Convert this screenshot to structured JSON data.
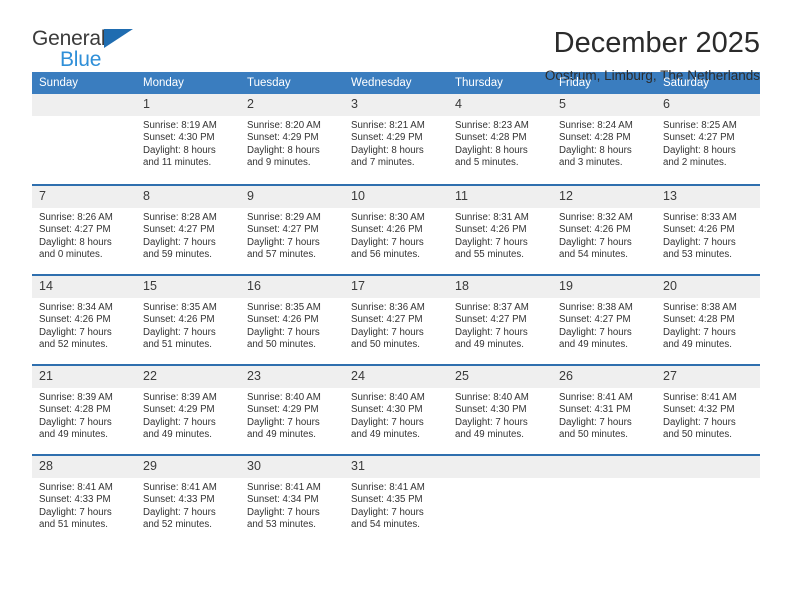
{
  "logo": {
    "line1": "General",
    "line2": "Blue",
    "triangle_color": "#1f6cb0",
    "line2_color": "#2f8fd8"
  },
  "header": {
    "title": "December 2025",
    "subtitle": "Oostrum, Limburg, The Netherlands"
  },
  "theme": {
    "header_bg": "#3a7dbf",
    "week_rule": "#2f6fae",
    "daynum_bg": "#efefef"
  },
  "weekday_headers": [
    "Sunday",
    "Monday",
    "Tuesday",
    "Wednesday",
    "Thursday",
    "Friday",
    "Saturday"
  ],
  "weeks": [
    [
      {
        "day": "",
        "sunrise": "",
        "sunset": "",
        "daylight1": "",
        "daylight2": "",
        "empty": true
      },
      {
        "day": "1",
        "sunrise": "Sunrise: 8:19 AM",
        "sunset": "Sunset: 4:30 PM",
        "daylight1": "Daylight: 8 hours",
        "daylight2": "and 11 minutes."
      },
      {
        "day": "2",
        "sunrise": "Sunrise: 8:20 AM",
        "sunset": "Sunset: 4:29 PM",
        "daylight1": "Daylight: 8 hours",
        "daylight2": "and 9 minutes."
      },
      {
        "day": "3",
        "sunrise": "Sunrise: 8:21 AM",
        "sunset": "Sunset: 4:29 PM",
        "daylight1": "Daylight: 8 hours",
        "daylight2": "and 7 minutes."
      },
      {
        "day": "4",
        "sunrise": "Sunrise: 8:23 AM",
        "sunset": "Sunset: 4:28 PM",
        "daylight1": "Daylight: 8 hours",
        "daylight2": "and 5 minutes."
      },
      {
        "day": "5",
        "sunrise": "Sunrise: 8:24 AM",
        "sunset": "Sunset: 4:28 PM",
        "daylight1": "Daylight: 8 hours",
        "daylight2": "and 3 minutes."
      },
      {
        "day": "6",
        "sunrise": "Sunrise: 8:25 AM",
        "sunset": "Sunset: 4:27 PM",
        "daylight1": "Daylight: 8 hours",
        "daylight2": "and 2 minutes."
      }
    ],
    [
      {
        "day": "7",
        "sunrise": "Sunrise: 8:26 AM",
        "sunset": "Sunset: 4:27 PM",
        "daylight1": "Daylight: 8 hours",
        "daylight2": "and 0 minutes."
      },
      {
        "day": "8",
        "sunrise": "Sunrise: 8:28 AM",
        "sunset": "Sunset: 4:27 PM",
        "daylight1": "Daylight: 7 hours",
        "daylight2": "and 59 minutes."
      },
      {
        "day": "9",
        "sunrise": "Sunrise: 8:29 AM",
        "sunset": "Sunset: 4:27 PM",
        "daylight1": "Daylight: 7 hours",
        "daylight2": "and 57 minutes."
      },
      {
        "day": "10",
        "sunrise": "Sunrise: 8:30 AM",
        "sunset": "Sunset: 4:26 PM",
        "daylight1": "Daylight: 7 hours",
        "daylight2": "and 56 minutes."
      },
      {
        "day": "11",
        "sunrise": "Sunrise: 8:31 AM",
        "sunset": "Sunset: 4:26 PM",
        "daylight1": "Daylight: 7 hours",
        "daylight2": "and 55 minutes."
      },
      {
        "day": "12",
        "sunrise": "Sunrise: 8:32 AM",
        "sunset": "Sunset: 4:26 PM",
        "daylight1": "Daylight: 7 hours",
        "daylight2": "and 54 minutes."
      },
      {
        "day": "13",
        "sunrise": "Sunrise: 8:33 AM",
        "sunset": "Sunset: 4:26 PM",
        "daylight1": "Daylight: 7 hours",
        "daylight2": "and 53 minutes."
      }
    ],
    [
      {
        "day": "14",
        "sunrise": "Sunrise: 8:34 AM",
        "sunset": "Sunset: 4:26 PM",
        "daylight1": "Daylight: 7 hours",
        "daylight2": "and 52 minutes."
      },
      {
        "day": "15",
        "sunrise": "Sunrise: 8:35 AM",
        "sunset": "Sunset: 4:26 PM",
        "daylight1": "Daylight: 7 hours",
        "daylight2": "and 51 minutes."
      },
      {
        "day": "16",
        "sunrise": "Sunrise: 8:35 AM",
        "sunset": "Sunset: 4:26 PM",
        "daylight1": "Daylight: 7 hours",
        "daylight2": "and 50 minutes."
      },
      {
        "day": "17",
        "sunrise": "Sunrise: 8:36 AM",
        "sunset": "Sunset: 4:27 PM",
        "daylight1": "Daylight: 7 hours",
        "daylight2": "and 50 minutes."
      },
      {
        "day": "18",
        "sunrise": "Sunrise: 8:37 AM",
        "sunset": "Sunset: 4:27 PM",
        "daylight1": "Daylight: 7 hours",
        "daylight2": "and 49 minutes."
      },
      {
        "day": "19",
        "sunrise": "Sunrise: 8:38 AM",
        "sunset": "Sunset: 4:27 PM",
        "daylight1": "Daylight: 7 hours",
        "daylight2": "and 49 minutes."
      },
      {
        "day": "20",
        "sunrise": "Sunrise: 8:38 AM",
        "sunset": "Sunset: 4:28 PM",
        "daylight1": "Daylight: 7 hours",
        "daylight2": "and 49 minutes."
      }
    ],
    [
      {
        "day": "21",
        "sunrise": "Sunrise: 8:39 AM",
        "sunset": "Sunset: 4:28 PM",
        "daylight1": "Daylight: 7 hours",
        "daylight2": "and 49 minutes."
      },
      {
        "day": "22",
        "sunrise": "Sunrise: 8:39 AM",
        "sunset": "Sunset: 4:29 PM",
        "daylight1": "Daylight: 7 hours",
        "daylight2": "and 49 minutes."
      },
      {
        "day": "23",
        "sunrise": "Sunrise: 8:40 AM",
        "sunset": "Sunset: 4:29 PM",
        "daylight1": "Daylight: 7 hours",
        "daylight2": "and 49 minutes."
      },
      {
        "day": "24",
        "sunrise": "Sunrise: 8:40 AM",
        "sunset": "Sunset: 4:30 PM",
        "daylight1": "Daylight: 7 hours",
        "daylight2": "and 49 minutes."
      },
      {
        "day": "25",
        "sunrise": "Sunrise: 8:40 AM",
        "sunset": "Sunset: 4:30 PM",
        "daylight1": "Daylight: 7 hours",
        "daylight2": "and 49 minutes."
      },
      {
        "day": "26",
        "sunrise": "Sunrise: 8:41 AM",
        "sunset": "Sunset: 4:31 PM",
        "daylight1": "Daylight: 7 hours",
        "daylight2": "and 50 minutes."
      },
      {
        "day": "27",
        "sunrise": "Sunrise: 8:41 AM",
        "sunset": "Sunset: 4:32 PM",
        "daylight1": "Daylight: 7 hours",
        "daylight2": "and 50 minutes."
      }
    ],
    [
      {
        "day": "28",
        "sunrise": "Sunrise: 8:41 AM",
        "sunset": "Sunset: 4:33 PM",
        "daylight1": "Daylight: 7 hours",
        "daylight2": "and 51 minutes."
      },
      {
        "day": "29",
        "sunrise": "Sunrise: 8:41 AM",
        "sunset": "Sunset: 4:33 PM",
        "daylight1": "Daylight: 7 hours",
        "daylight2": "and 52 minutes."
      },
      {
        "day": "30",
        "sunrise": "Sunrise: 8:41 AM",
        "sunset": "Sunset: 4:34 PM",
        "daylight1": "Daylight: 7 hours",
        "daylight2": "and 53 minutes."
      },
      {
        "day": "31",
        "sunrise": "Sunrise: 8:41 AM",
        "sunset": "Sunset: 4:35 PM",
        "daylight1": "Daylight: 7 hours",
        "daylight2": "and 54 minutes."
      },
      {
        "day": "",
        "sunrise": "",
        "sunset": "",
        "daylight1": "",
        "daylight2": "",
        "empty": true
      },
      {
        "day": "",
        "sunrise": "",
        "sunset": "",
        "daylight1": "",
        "daylight2": "",
        "empty": true
      },
      {
        "day": "",
        "sunrise": "",
        "sunset": "",
        "daylight1": "",
        "daylight2": "",
        "empty": true
      }
    ]
  ]
}
